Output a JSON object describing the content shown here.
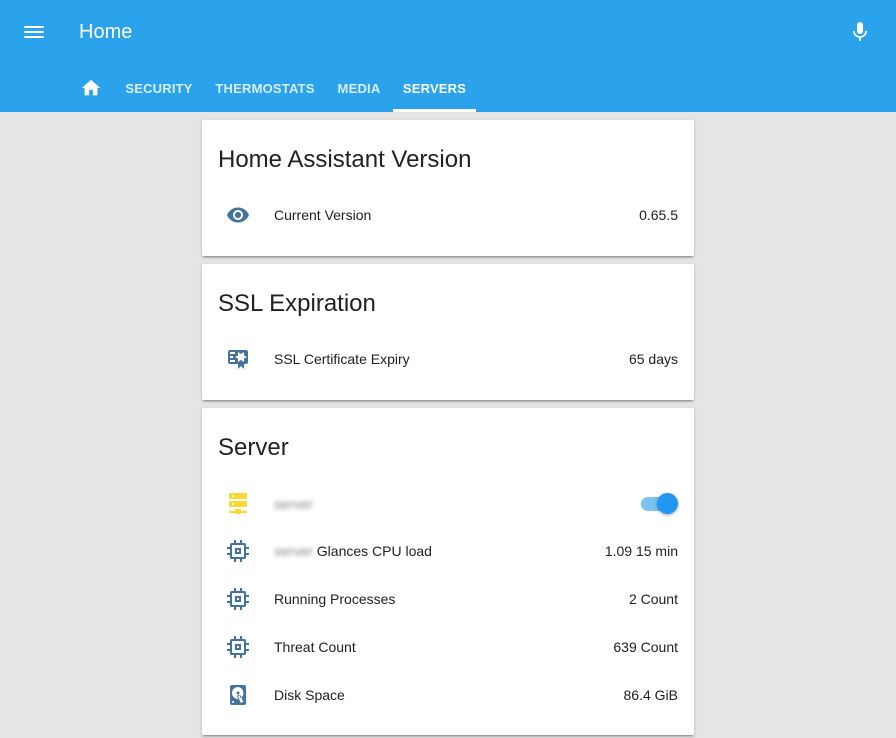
{
  "header": {
    "title": "Home",
    "tabs": [
      {
        "label": "SECURITY"
      },
      {
        "label": "THERMOSTATS"
      },
      {
        "label": "MEDIA"
      },
      {
        "label": "SERVERS"
      }
    ],
    "active_tab": "SERVERS"
  },
  "colors": {
    "header": "#2aa3ec",
    "icon": "#44739e",
    "server_icon": "#fdd835",
    "toggle_on": "#2196f3"
  },
  "cards": {
    "version": {
      "title": "Home Assistant Version",
      "rows": [
        {
          "icon": "eye-icon",
          "label": "Current Version",
          "value": "0.65.5"
        }
      ]
    },
    "ssl": {
      "title": "SSL Expiration",
      "rows": [
        {
          "icon": "certificate-icon",
          "label": "SSL Certificate Expiry",
          "value": "65 days"
        }
      ]
    },
    "server": {
      "title": "Server",
      "switch": {
        "icon": "server-icon",
        "label": "server",
        "state": "on"
      },
      "rows": [
        {
          "icon": "chip-icon",
          "label_blurred": "server",
          "label": " Glances CPU load",
          "value": "1.09 15 min"
        },
        {
          "icon": "chip-icon",
          "label": "Running Processes",
          "value": "2 Count"
        },
        {
          "icon": "chip-icon",
          "label": "Threat Count",
          "value": "639 Count"
        },
        {
          "icon": "harddisk-icon",
          "label": "Disk Space",
          "value": "86.4 GiB"
        }
      ]
    }
  }
}
